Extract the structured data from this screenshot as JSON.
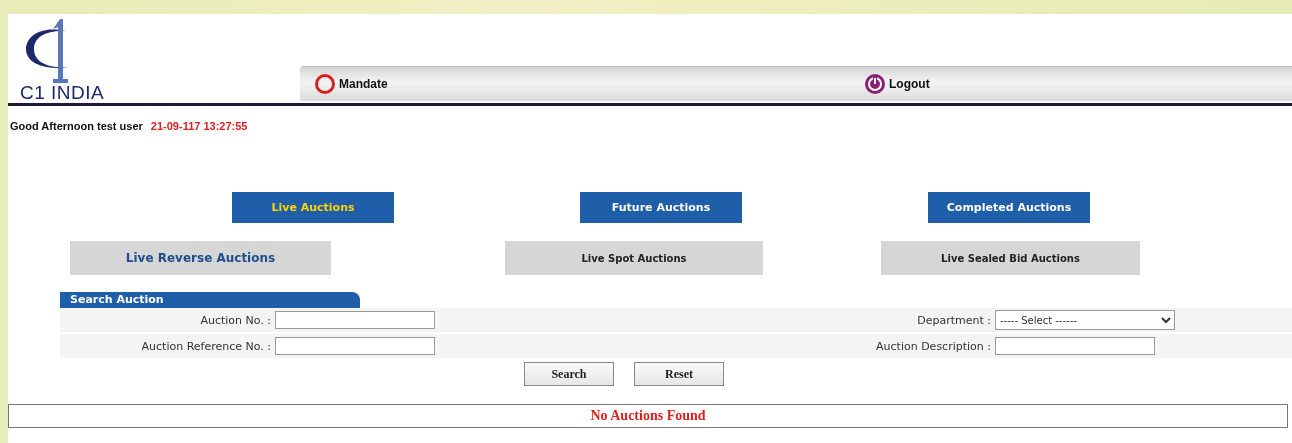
{
  "logo": {
    "text": "C1 INDIA"
  },
  "nav": [
    {
      "kind": "ring",
      "label": "Mandate"
    },
    {
      "kind": "power",
      "label": "Logout"
    }
  ],
  "greeting": {
    "text": "Good Afternoon test user",
    "datetime": "21-09-117 13:27:55"
  },
  "auction_tabs": [
    {
      "label": "Live Auctions",
      "selected": true
    },
    {
      "label": "Future Auctions",
      "selected": false
    },
    {
      "label": "Completed Auctions",
      "selected": false
    }
  ],
  "auction_types": [
    {
      "label": "Live Reverse Auctions",
      "selected": true
    },
    {
      "label": "Live Spot Auctions",
      "selected": false
    },
    {
      "label": "Live Sealed Bid Auctions",
      "selected": false
    }
  ],
  "search": {
    "title": "Search Auction",
    "fields": [
      {
        "label": "Auction No. :",
        "kind": "text"
      },
      {
        "label": "Department :",
        "kind": "select",
        "value": "----- Select ------"
      },
      {
        "label": "Auction Reference No. :",
        "kind": "text"
      },
      {
        "label": "Auction Description :",
        "kind": "text"
      }
    ],
    "buttons": [
      "Search",
      "Reset"
    ]
  },
  "result": {
    "message": "No Auctions Found"
  }
}
